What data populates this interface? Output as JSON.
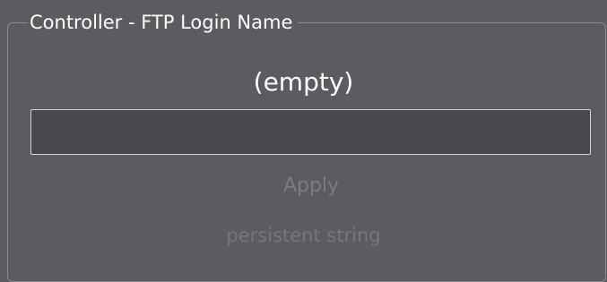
{
  "group": {
    "title": "Controller - FTP Login Name"
  },
  "value_display": "(empty)",
  "input": {
    "value": ""
  },
  "apply_label": "Apply",
  "type_label": "persistent string",
  "colors": {
    "background": "#5c5c60",
    "input_background": "#49494d",
    "input_border": "#d4d4d8",
    "text": "#ffffff",
    "disabled_text": "#7c7c80"
  }
}
